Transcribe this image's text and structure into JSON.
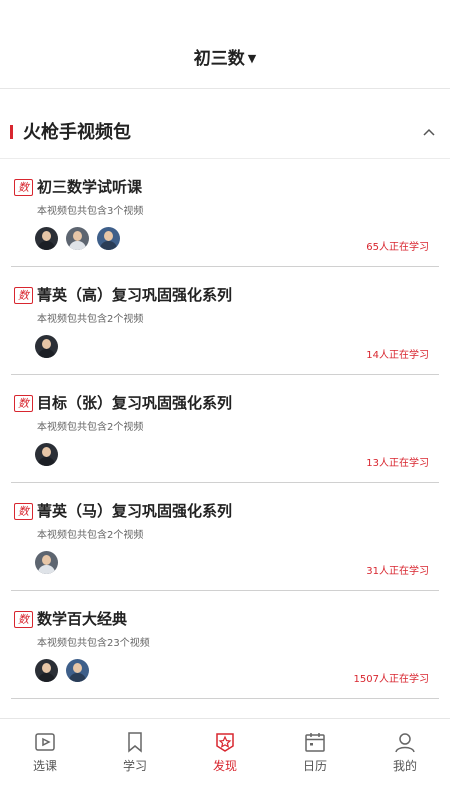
{
  "header": {
    "title": "初三数"
  },
  "section": {
    "title": "火枪手视频包"
  },
  "packages": [
    {
      "badge": "数",
      "title": "初三数学试听课",
      "subtitle": "本视频包共包含3个视频",
      "learning": "65人正在学习"
    },
    {
      "badge": "数",
      "title": "菁英（高）复习巩固强化系列",
      "subtitle": "本视频包共包含2个视频",
      "learning": "14人正在学习"
    },
    {
      "badge": "数",
      "title": "目标（张）复习巩固强化系列",
      "subtitle": "本视频包共包含2个视频",
      "learning": "13人正在学习"
    },
    {
      "badge": "数",
      "title": "菁英（马）复习巩固强化系列",
      "subtitle": "本视频包共包含2个视频",
      "learning": "31人正在学习"
    },
    {
      "badge": "数",
      "title": "数学百大经典",
      "subtitle": "本视频包共包含23个视频",
      "learning": "1507人正在学习"
    }
  ],
  "tabs": [
    {
      "label": "选课",
      "icon": "play-box-icon"
    },
    {
      "label": "学习",
      "icon": "bookmark-icon"
    },
    {
      "label": "发现",
      "icon": "discover-badge-icon",
      "active": true
    },
    {
      "label": "日历",
      "icon": "calendar-icon"
    },
    {
      "label": "我的",
      "icon": "person-icon"
    }
  ],
  "colors": {
    "accent": "#d8262f",
    "text": "#222222",
    "muted": "#666666"
  }
}
